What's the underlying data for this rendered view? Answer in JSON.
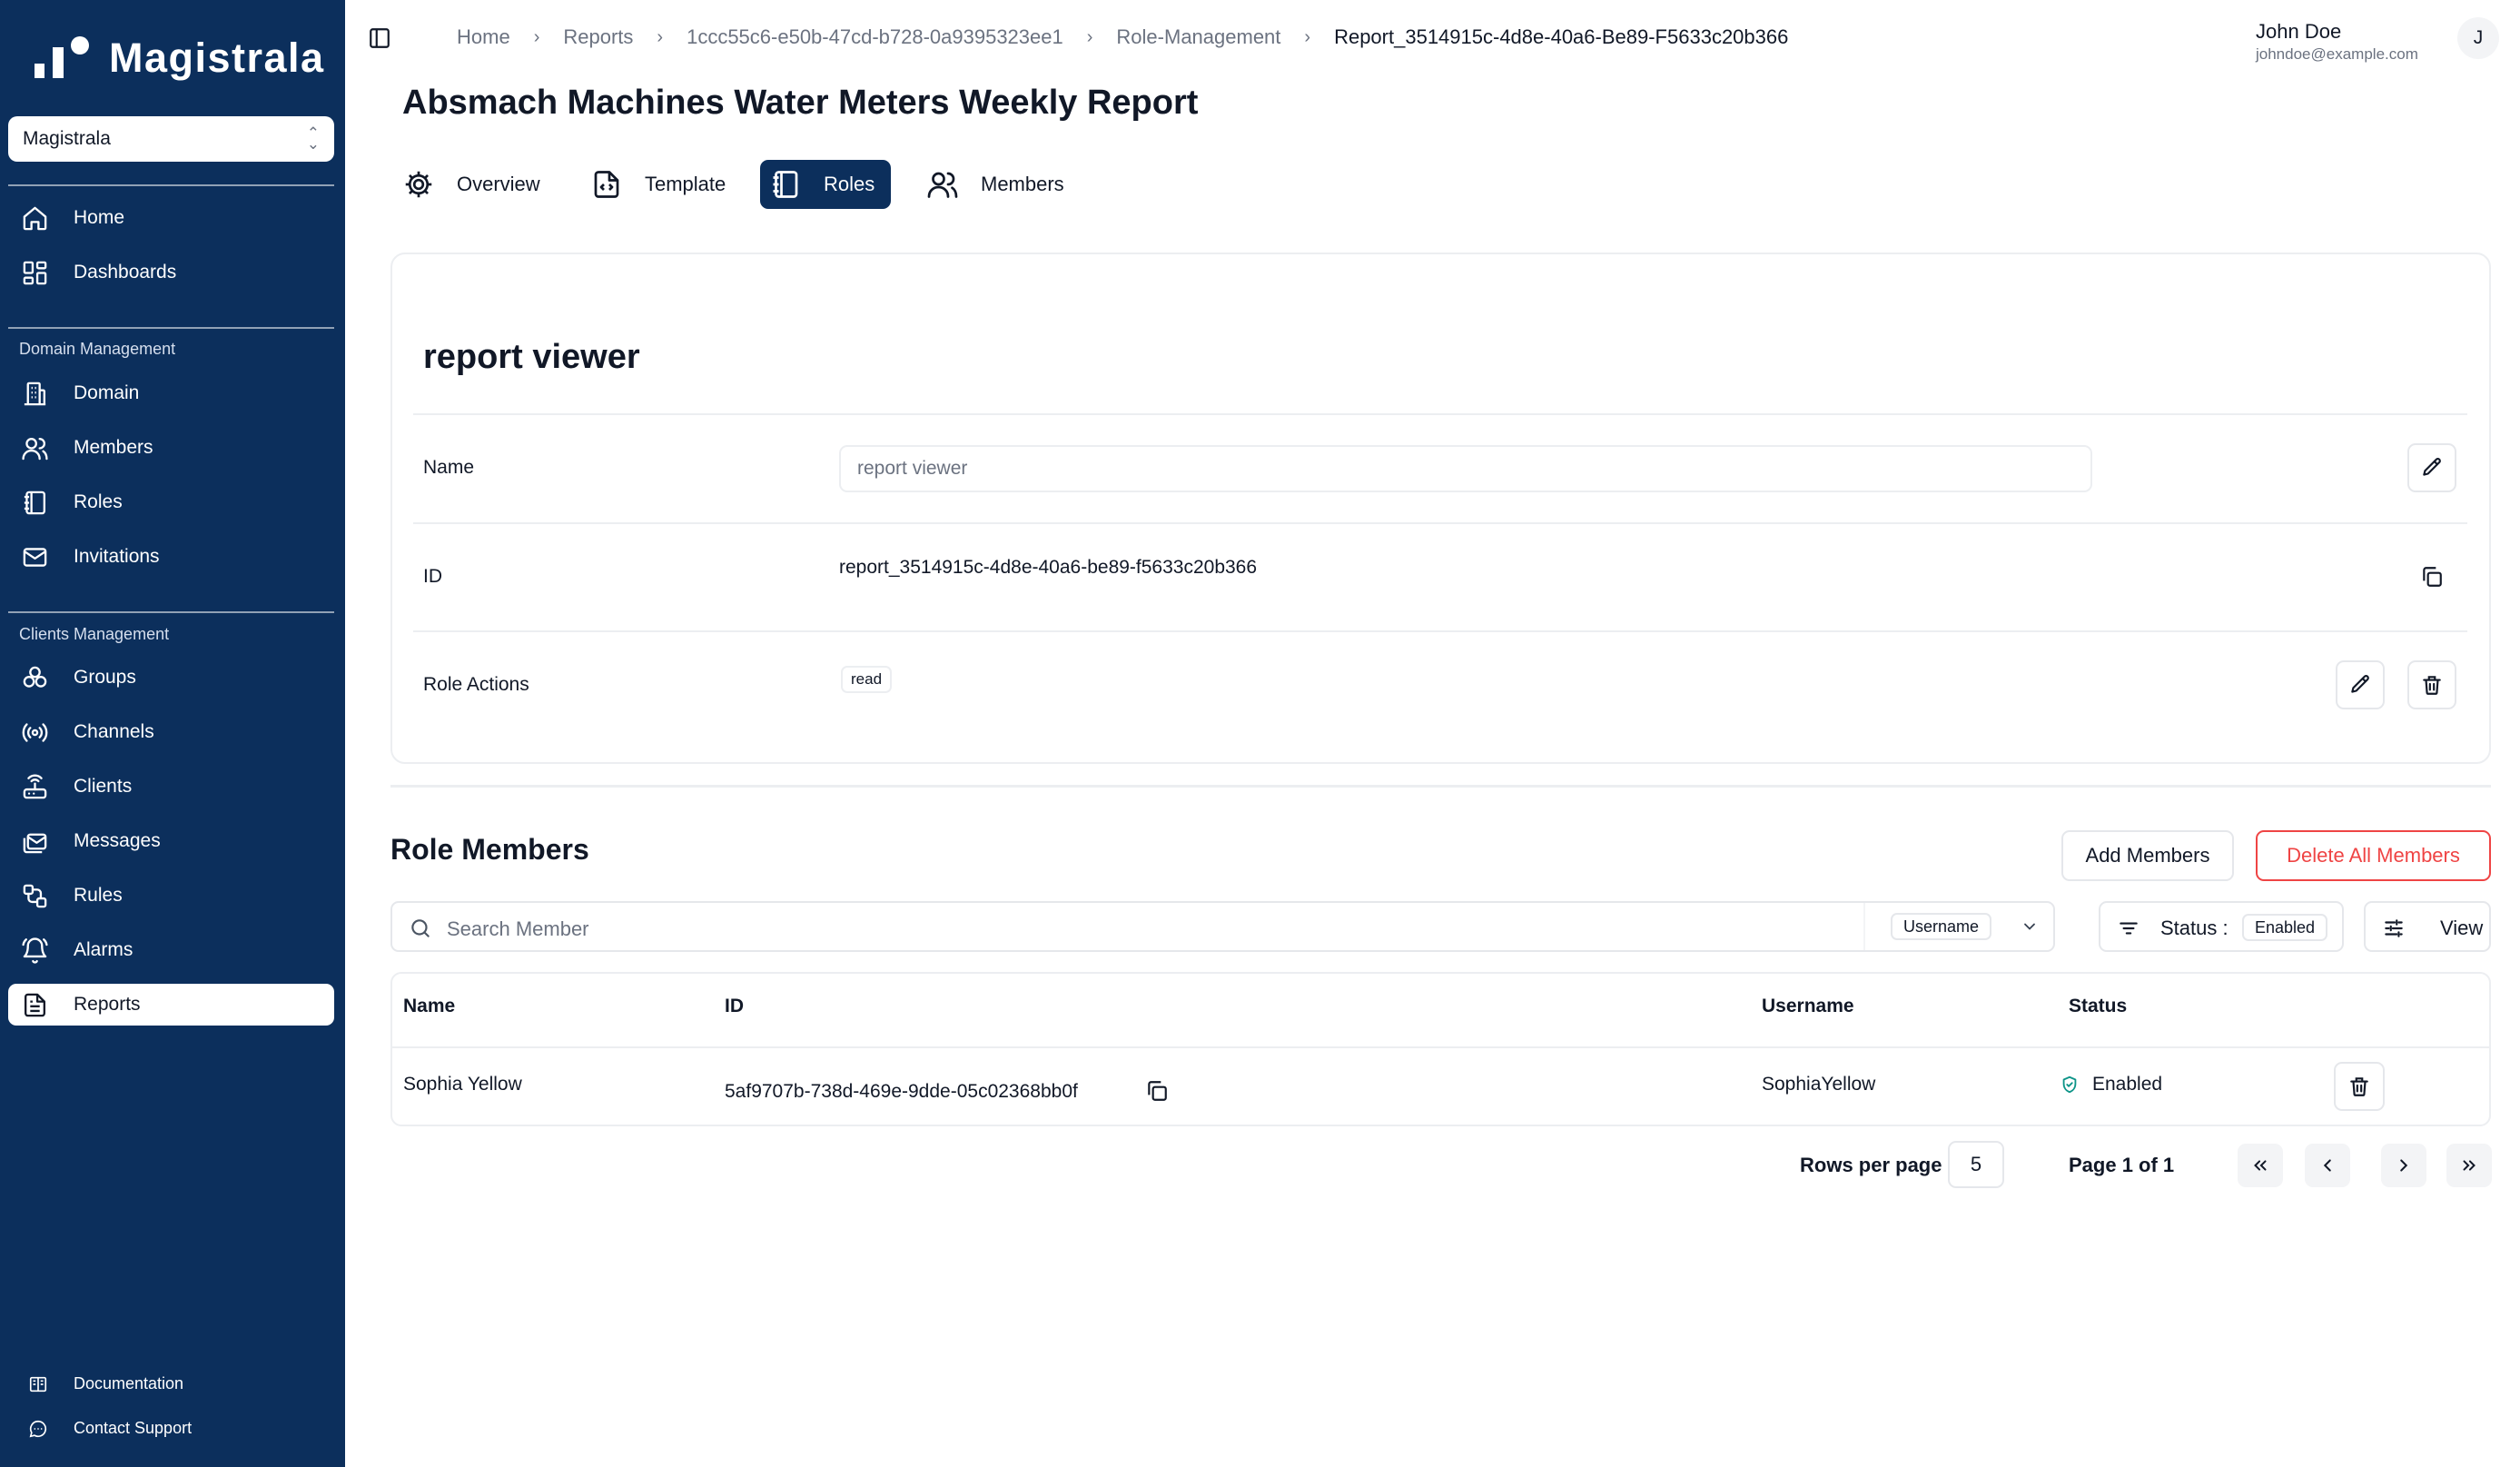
{
  "brand": {
    "name": "Magistrala"
  },
  "workspace": {
    "selected": "Magistrala"
  },
  "sidebar": {
    "top_items": [
      {
        "label": "Home",
        "icon": "home-icon"
      },
      {
        "label": "Dashboards",
        "icon": "dashboard-icon"
      }
    ],
    "domain_group": {
      "label": "Domain Management",
      "items": [
        {
          "label": "Domain",
          "icon": "building-icon"
        },
        {
          "label": "Members",
          "icon": "users-icon"
        },
        {
          "label": "Roles",
          "icon": "notebook-icon"
        },
        {
          "label": "Invitations",
          "icon": "mail-icon"
        }
      ]
    },
    "clients_group": {
      "label": "Clients Management",
      "items": [
        {
          "label": "Groups",
          "icon": "groups-icon"
        },
        {
          "label": "Channels",
          "icon": "radio-icon"
        },
        {
          "label": "Clients",
          "icon": "router-icon"
        },
        {
          "label": "Messages",
          "icon": "mail-stack-icon"
        },
        {
          "label": "Rules",
          "icon": "rules-icon"
        },
        {
          "label": "Alarms",
          "icon": "bell-icon"
        },
        {
          "label": "Reports",
          "icon": "file-text-icon",
          "active": true
        }
      ]
    },
    "footer": [
      {
        "label": "Documentation",
        "icon": "book-icon"
      },
      {
        "label": "Contact Support",
        "icon": "chat-icon"
      }
    ]
  },
  "breadcrumb": [
    "Home",
    "Reports",
    "1ccc55c6-e50b-47cd-b728-0a9395323ee1",
    "Role-Management",
    "Report_3514915c-4d8e-40a6-Be89-F5633c20b366"
  ],
  "user": {
    "name": "John Doe",
    "email": "johndoe@example.com",
    "initial": "J"
  },
  "page": {
    "title": "Absmach Machines Water Meters Weekly Report"
  },
  "tabs": [
    {
      "label": "Overview",
      "icon": "gear-icon"
    },
    {
      "label": "Template",
      "icon": "file-code-icon"
    },
    {
      "label": "Roles",
      "icon": "notebook-icon",
      "active": true
    },
    {
      "label": "Members",
      "icon": "users-icon"
    }
  ],
  "role": {
    "title": "report viewer",
    "name_label": "Name",
    "name_placeholder": "report viewer",
    "id_label": "ID",
    "id_value": "report_3514915c-4d8e-40a6-be89-f5633c20b366",
    "actions_label": "Role Actions",
    "actions": [
      "read"
    ]
  },
  "members": {
    "title": "Role Members",
    "add_label": "Add Members",
    "delete_all_label": "Delete All Members",
    "search_placeholder": "Search Member",
    "search_type": "Username",
    "status_label": "Status :",
    "status_value": "Enabled",
    "view_label": "View",
    "columns": [
      "Name",
      "ID",
      "Username",
      "Status"
    ],
    "rows": [
      {
        "name": "Sophia Yellow",
        "id": "5af9707b-738d-469e-9dde-05c02368bb0f",
        "username": "SophiaYellow",
        "status": "Enabled"
      }
    ]
  },
  "pagination": {
    "rows_label": "Rows per page",
    "rows_value": "5",
    "page_info": "Page 1 of 1"
  },
  "colors": {
    "sidebar": "#0c2f5c",
    "danger": "#ef4444",
    "success": "#0d9488"
  }
}
